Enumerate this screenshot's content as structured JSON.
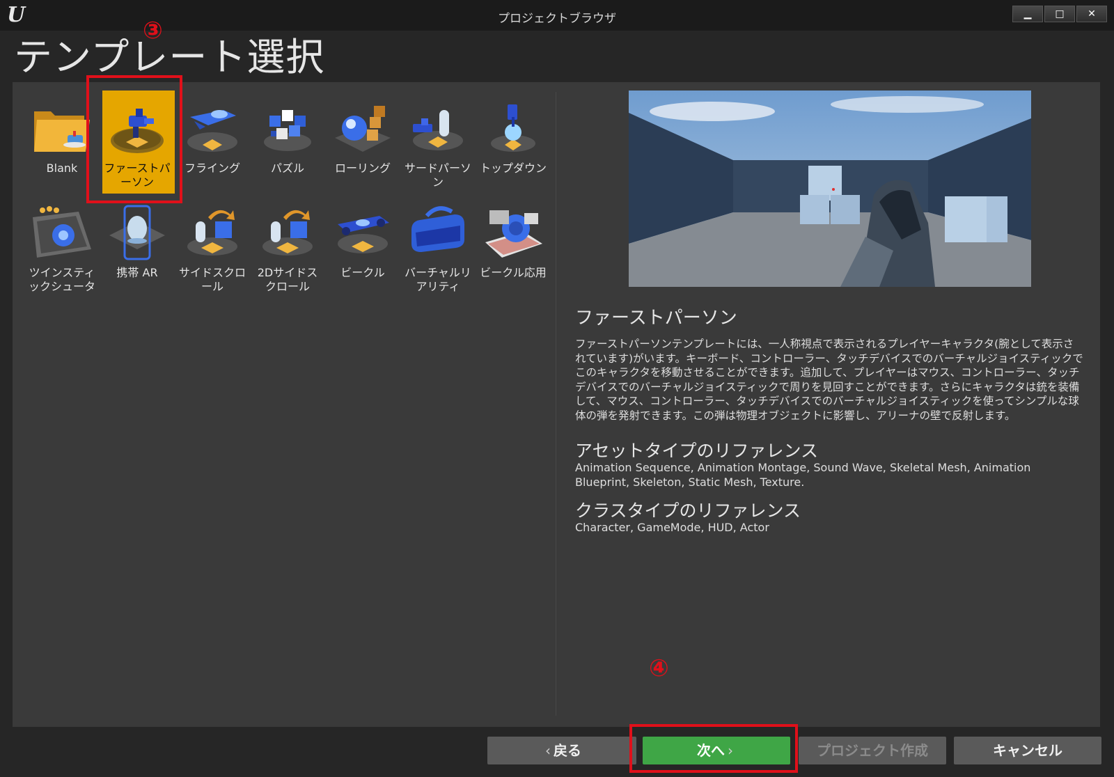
{
  "window": {
    "title": "プロジェクトブラウザ",
    "controls": {
      "minimize": "▁",
      "maximize": "□",
      "close": "✕"
    }
  },
  "page_title": "テンプレート選択",
  "templates": [
    {
      "label": "Blank",
      "icon": "folder-icon"
    },
    {
      "label": "ファーストパーソン",
      "icon": "first-person-icon",
      "selected": true
    },
    {
      "label": "フライング",
      "icon": "flying-icon"
    },
    {
      "label": "パズル",
      "icon": "puzzle-icon"
    },
    {
      "label": "ローリング",
      "icon": "rolling-icon"
    },
    {
      "label": "サードパーソン",
      "icon": "third-person-icon"
    },
    {
      "label": "トップダウン",
      "icon": "top-down-icon"
    },
    {
      "label": "ツインスティックシュータ",
      "icon": "twin-stick-icon"
    },
    {
      "label": "携帯 AR",
      "icon": "handheld-ar-icon"
    },
    {
      "label": "サイドスクロール",
      "icon": "side-scroll-icon"
    },
    {
      "label": "2Dサイドスクロール",
      "icon": "2d-side-scroll-icon"
    },
    {
      "label": "ビークル",
      "icon": "vehicle-icon"
    },
    {
      "label": "バーチャルリアリティ",
      "icon": "vr-headset-icon"
    },
    {
      "label": "ビークル応用",
      "icon": "vehicle-advanced-icon"
    }
  ],
  "details": {
    "title": "ファーストパーソン",
    "description": "ファーストパーソンテンプレートには、一人称視点で表示されるプレイヤーキャラクタ(腕として表示されています)がいます。キーボード、コントローラー、タッチデバイスでのバーチャルジョイスティックでこのキャラクタを移動させることができます。追加して、プレイヤーはマウス、コントローラー、タッチデバイスでのバーチャルジョイスティックで周りを見回すことができます。さらにキャラクタは銃を装備して、マウス、コントローラー、タッチデバイスでのバーチャルジョイスティックを使ってシンプルな球体の弾を発射できます。この弾は物理オブジェクトに影響し、アリーナの壁で反射します。",
    "asset_types_heading": "アセットタイプのリファレンス",
    "asset_types": "Animation Sequence, Animation Montage, Sound Wave, Skeletal Mesh, Animation Blueprint, Skeleton, Static Mesh, Texture.",
    "class_types_heading": "クラスタイプのリファレンス",
    "class_types": "Character, GameMode, HUD, Actor"
  },
  "buttons": {
    "back": "戻る",
    "next": "次へ",
    "create": "プロジェクト作成",
    "cancel": "キャンセル"
  },
  "annotations": {
    "step3": "③",
    "step4": "④"
  },
  "colors": {
    "selected_tile": "#e5a600",
    "next_button": "#3fa646",
    "annotation_red": "#e0101a"
  }
}
